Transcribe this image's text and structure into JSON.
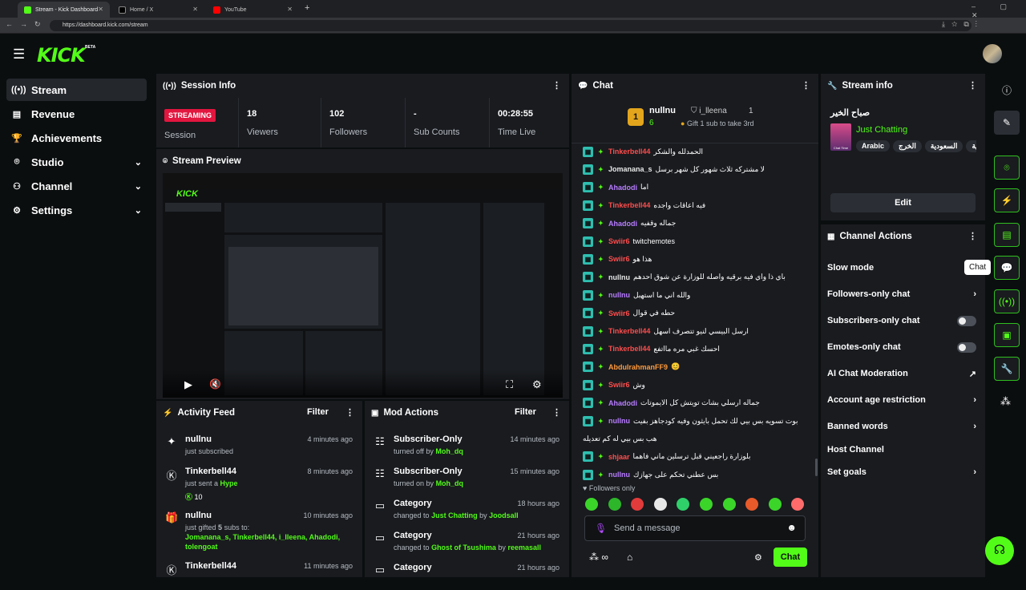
{
  "browser": {
    "tabs": [
      "Stream - Kick Dashboard",
      "Home / X",
      "YouTube"
    ],
    "new_tab": "+",
    "url": "https://dashboard.kick.com/stream"
  },
  "header": {
    "logo": "KICK",
    "beta": "BETA"
  },
  "sidebar": {
    "items": [
      {
        "label": "Stream",
        "icon": "broadcast-icon"
      },
      {
        "label": "Revenue",
        "icon": "chart-icon"
      },
      {
        "label": "Achievements",
        "icon": "trophy-icon"
      },
      {
        "label": "Studio",
        "icon": "studio-icon"
      },
      {
        "label": "Channel",
        "icon": "channel-icon"
      },
      {
        "label": "Settings",
        "icon": "gear-icon"
      }
    ]
  },
  "session": {
    "title": "Session Info",
    "badge": "STREAMING",
    "session_label": "Session",
    "stats": [
      {
        "value": "18",
        "label": "Viewers"
      },
      {
        "value": "102",
        "label": "Followers"
      },
      {
        "value": "-",
        "label": "Sub Counts"
      },
      {
        "value": "00:28:55",
        "label": "Time Live"
      }
    ]
  },
  "preview": {
    "title": "Stream Preview"
  },
  "activity": {
    "title": "Activity Feed",
    "filter": "Filter",
    "rows": [
      {
        "user": "nullnu",
        "line": "just subscribed",
        "time": "4 minutes ago"
      },
      {
        "user": "Tinkerbell44",
        "line": "just sent a",
        "kick": "Hype",
        "amount": "10",
        "time": "8 minutes ago"
      },
      {
        "user": "nullnu",
        "line_a": "just gifted",
        "count": "5",
        "line_b": "subs to:",
        "names": "Jomanana_s, Tinkerbell44, i_lleena, Ahadodi,",
        "names2": "tolengoat",
        "time": "10 minutes ago"
      },
      {
        "user": "Tinkerbell44",
        "time": "11 minutes ago"
      }
    ]
  },
  "mod": {
    "title": "Mod Actions",
    "filter": "Filter",
    "rows": [
      {
        "title": "Subscriber-Only",
        "pre": "turned off by",
        "who": "Moh_dq",
        "time": "14 minutes ago"
      },
      {
        "title": "Subscriber-Only",
        "pre": "turned on by",
        "who": "Moh_dq",
        "time": "15 minutes ago"
      },
      {
        "title": "Category",
        "pre": "changed to",
        "val": "Just Chatting",
        "mid": "by",
        "who": "Joodsall",
        "time": "18 hours ago"
      },
      {
        "title": "Category",
        "pre": "changed to",
        "val": "Ghost of Tsushima",
        "mid": "by",
        "who": "reemasall",
        "time": "21 hours ago"
      },
      {
        "title": "Category",
        "time": "21 hours ago"
      }
    ]
  },
  "chat": {
    "title": "Chat",
    "top": {
      "rank": "1",
      "name": "nullnu",
      "count": "6",
      "second": "i_lleena",
      "second_count": "1",
      "gift": "Gift 1 sub to take 3rd"
    },
    "messages": [
      {
        "user": "Tinkerbell44",
        "color": "#ff4d4d",
        "text": "الحمدلله والشكر"
      },
      {
        "user": "Jomanana_s",
        "color": "#e8e8e8",
        "text": "لا مشتركه ثلاث شهور كل شهر برسل"
      },
      {
        "user": "Ahadodi",
        "color": "#b77cff",
        "text": "اما"
      },
      {
        "user": "Tinkerbell44",
        "color": "#ff4d4d",
        "text": "فيه اعاقات واجده"
      },
      {
        "user": "Ahadodi",
        "color": "#b77cff",
        "text": "جماله وقفيه"
      },
      {
        "user": "Swiir6",
        "color": "#ff4d4d",
        "text": "twitchemotes"
      },
      {
        "user": "Swiir6",
        "color": "#ff4d4d",
        "text": "هذا هو"
      },
      {
        "user": "nullnu",
        "color": "#e8e8e8",
        "text": "باي ذا واي فيه برقيه واصله للوزارة عن شوق احدهم"
      },
      {
        "user": "nullnu",
        "color": "#b77cff",
        "text": "والله اني ما استهبل"
      },
      {
        "user": "Swiir6",
        "color": "#ff4d4d",
        "text": "حطه في قوال"
      },
      {
        "user": "Tinkerbell44",
        "color": "#ff4d4d",
        "text": "ارسل البيسي لنيو تتصرف اسهل"
      },
      {
        "user": "Tinkerbell44",
        "color": "#ff4d4d",
        "text": "احسك غبي مره مااتفع"
      },
      {
        "user": "AbdulrahmanFF9",
        "color": "#ff9a3c",
        "text": "😊"
      },
      {
        "user": "Swiir6",
        "color": "#ff4d4d",
        "text": "وش"
      },
      {
        "user": "Ahadodi",
        "color": "#b77cff",
        "text": "جماله ارسلي بشات تويتش كل الايموتات"
      },
      {
        "user": "nullnu",
        "color": "#b77cff",
        "text": "بوت تسويه بس بيي لك تحمل بايثون وفيه كودجاهز بفيت"
      },
      {
        "user": "",
        "color": "#e8e8e8",
        "text": "هب بس بيي له كم تعديله"
      },
      {
        "user": "shjaar",
        "color": "#ff4d4d",
        "text": "بلوزارة راجعيني قبل ترسلين ماني فاهما"
      },
      {
        "user": "nullnu",
        "color": "#b77cff",
        "text": "بس عطني تحكم على جهازك"
      }
    ],
    "followers_only": "Followers only",
    "placeholder": "Send a message",
    "send": "Chat",
    "tooltip": "Chat"
  },
  "stream_info": {
    "title": "Stream info",
    "stream_title": "صباح الخير",
    "category": "Just Chatting",
    "tags": [
      "Arabic",
      "الخرج",
      "السعودية",
      "عربية"
    ],
    "thumb_text": "Chat Time",
    "edit": "Edit"
  },
  "channel_actions": {
    "title": "Channel Actions",
    "items": [
      "Slow mode",
      "Followers-only chat",
      "Subscribers-only chat",
      "Emotes-only chat",
      "AI Chat Moderation",
      "Account age restriction",
      "Banned words",
      "Host Channel",
      "Set goals"
    ]
  },
  "colors": {
    "accent": "#53fc18",
    "live": "#e2163f",
    "panel": "#191b1f"
  }
}
